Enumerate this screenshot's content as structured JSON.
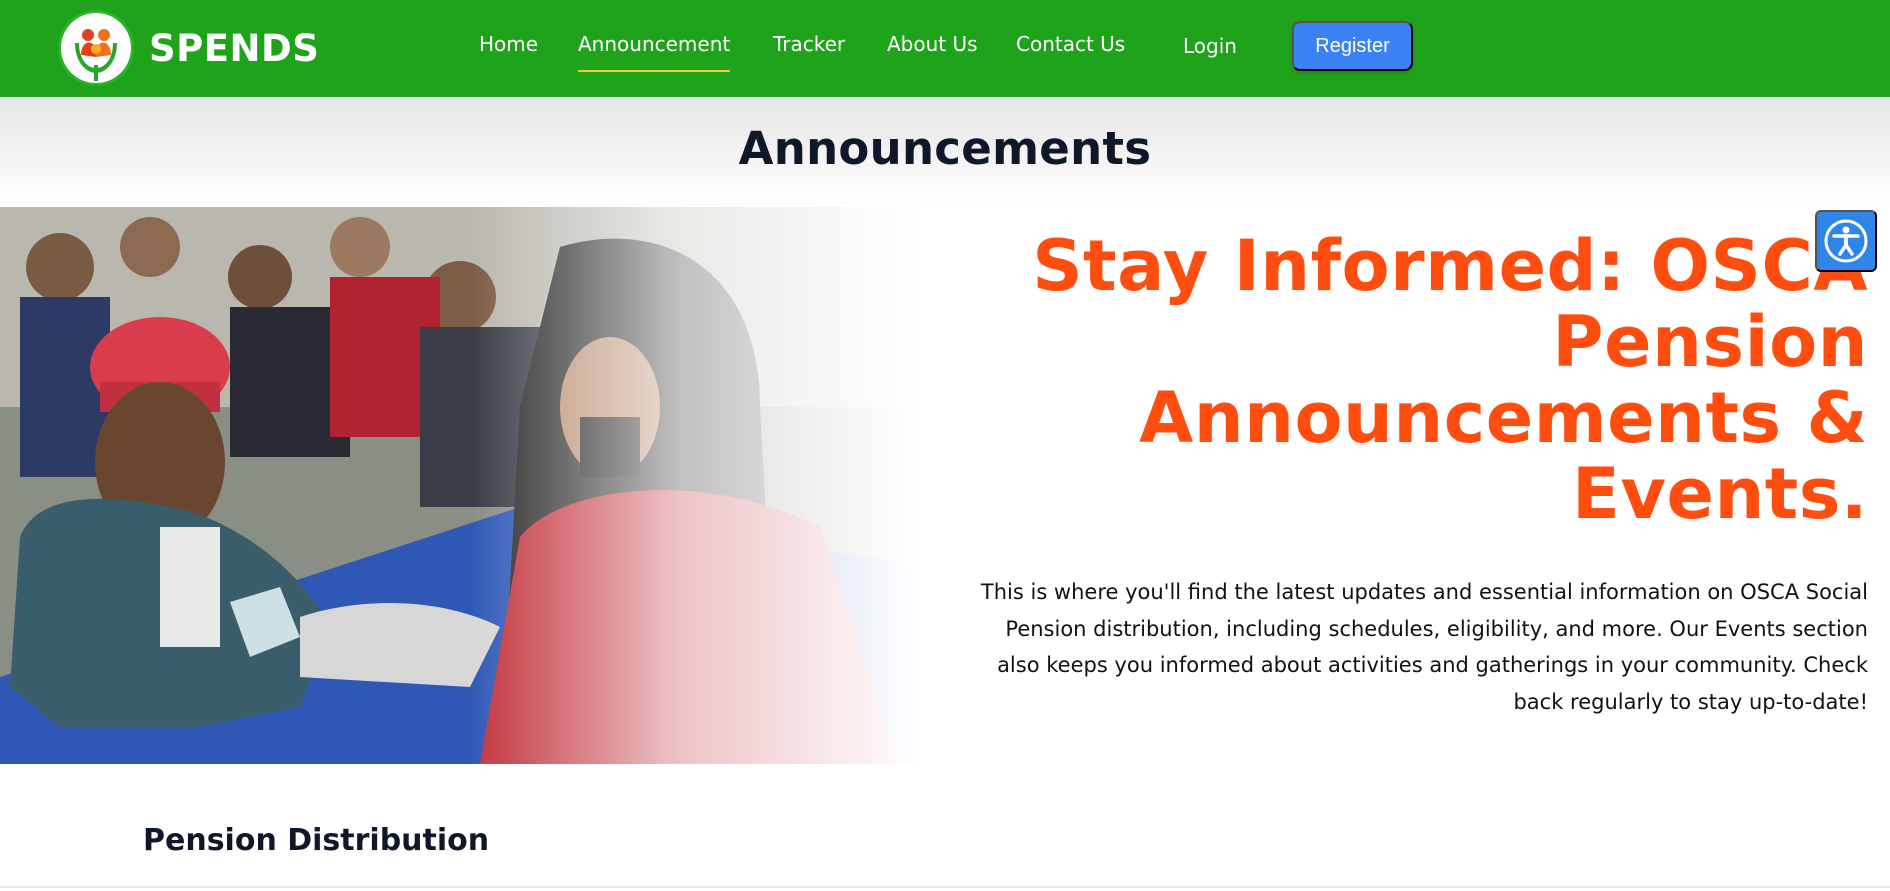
{
  "header": {
    "brand_name": "SPENDS",
    "logo_icon": "hands-family-logo",
    "nav": [
      {
        "label": "Home"
      },
      {
        "label": "Announcement",
        "active": true
      },
      {
        "label": "Tracker"
      },
      {
        "label": "About Us"
      },
      {
        "label": "Contact Us"
      },
      {
        "label": "Login"
      }
    ],
    "register_label": "Register",
    "colors": {
      "nav_bg": "#1fa31a",
      "register_bg": "#3b82f6",
      "active_underline": "#f4c542"
    }
  },
  "page": {
    "title": "Announcements"
  },
  "hero": {
    "heading_lines": [
      "Stay Informed: OSCA",
      "Pension",
      "Announcements &",
      "Events."
    ],
    "description": "This is where you'll find the latest updates and essential information on OSCA Social Pension distribution, including schedules, eligibility, and more. Our Events section also keeps you informed about activities and gatherings in your community. Check back regularly to stay up-to-date!",
    "heading_color": "#ff4c0f",
    "photo_icon": "pension-distribution-photo"
  },
  "accessibility": {
    "icon": "accessibility-icon",
    "color": "#2f86e8"
  },
  "sections": {
    "pension_distribution_title": "Pension Distribution"
  }
}
